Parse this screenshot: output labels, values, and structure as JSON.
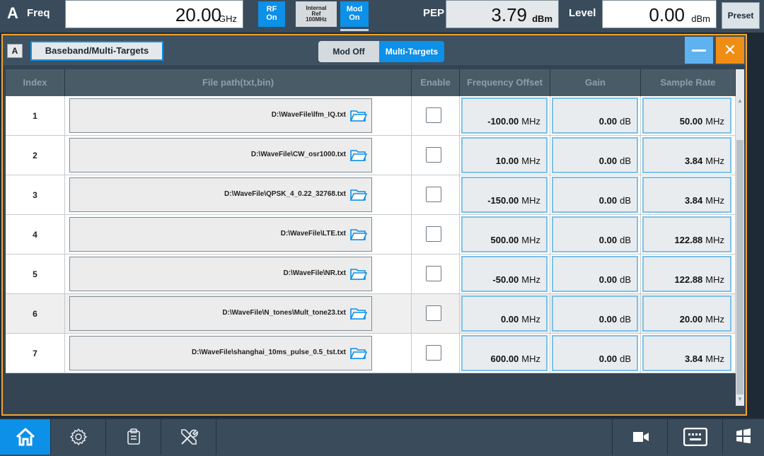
{
  "topbar": {
    "block": "A",
    "freq_label": "Freq",
    "freq_value": "20.00",
    "freq_unit": "GHz",
    "rf_line1": "RF",
    "rf_line2": "On",
    "ref_line1": "Internal",
    "ref_line2": "Ref",
    "ref_line3": "100MHz",
    "mod_line1": "Mod",
    "mod_line2": "On",
    "pep_label": "PEP",
    "pep_value": "3.79",
    "pep_unit": "dBm",
    "level_label": "Level",
    "level_value": "0.00",
    "level_unit": "dBm",
    "preset_label": "Preset"
  },
  "dialog": {
    "block": "A",
    "title": "Baseband/Multi-Targets",
    "seg_off": "Mod Off",
    "seg_on": "Multi-Targets",
    "close_symbol": "✕"
  },
  "table": {
    "headers": [
      "Index",
      "File path(txt,bin)",
      "Enable",
      "Frequency Offset",
      "Gain",
      "Sample Rate"
    ],
    "rows": [
      {
        "index": "1",
        "path": "D:\\WaveFile\\lfm_IQ.txt",
        "freq": "-100.00",
        "freq_unit": "MHz",
        "gain": "0.00",
        "gain_unit": "dB",
        "rate": "50.00",
        "rate_unit": "MHz"
      },
      {
        "index": "2",
        "path": "D:\\WaveFile\\CW_osr1000.txt",
        "freq": "10.00",
        "freq_unit": "MHz",
        "gain": "0.00",
        "gain_unit": "dB",
        "rate": "3.84",
        "rate_unit": "MHz"
      },
      {
        "index": "3",
        "path": "D:\\WaveFile\\QPSK_4_0.22_32768.txt",
        "freq": "-150.00",
        "freq_unit": "MHz",
        "gain": "0.00",
        "gain_unit": "dB",
        "rate": "3.84",
        "rate_unit": "MHz"
      },
      {
        "index": "4",
        "path": "D:\\WaveFile\\LTE.txt",
        "freq": "500.00",
        "freq_unit": "MHz",
        "gain": "0.00",
        "gain_unit": "dB",
        "rate": "122.88",
        "rate_unit": "MHz"
      },
      {
        "index": "5",
        "path": "D:\\WaveFile\\NR.txt",
        "freq": "-50.00",
        "freq_unit": "MHz",
        "gain": "0.00",
        "gain_unit": "dB",
        "rate": "122.88",
        "rate_unit": "MHz"
      },
      {
        "index": "6",
        "path": "D:\\WaveFile\\N_tones\\Mult_tone23.txt",
        "freq": "0.00",
        "freq_unit": "MHz",
        "gain": "0.00",
        "gain_unit": "dB",
        "rate": "20.00",
        "rate_unit": "MHz"
      },
      {
        "index": "7",
        "path": "D:\\WaveFile\\shanghai_10ms_pulse_0.5_tst.txt",
        "freq": "600.00",
        "freq_unit": "MHz",
        "gain": "0.00",
        "gain_unit": "dB",
        "rate": "3.84",
        "rate_unit": "MHz"
      }
    ]
  },
  "taskbar": {
    "icons": [
      "home-icon",
      "gear-icon",
      "clipboard-icon",
      "tools-icon",
      "camera-icon",
      "keyboard-icon",
      "windows-icon"
    ]
  },
  "colors": {
    "accent_blue": "#0d90e8",
    "dialog_border": "#f3a52f",
    "close_orange": "#f08d14"
  }
}
